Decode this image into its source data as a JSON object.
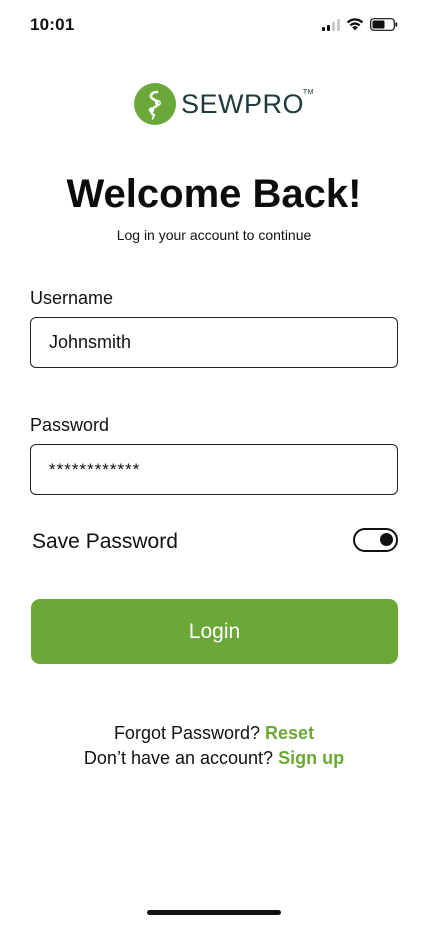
{
  "status_bar": {
    "time": "10:01",
    "battery_level": 0.6,
    "signal_bars_active": 2,
    "signal_bars_total": 4
  },
  "logo": {
    "text": "SEWPRO",
    "trademark": "TM",
    "brand_color": "#6ba838"
  },
  "header": {
    "title": "Welcome Back!",
    "subtitle": "Log in your account to continue"
  },
  "form": {
    "username_label": "Username",
    "username_value": "Johnsmith",
    "password_label": "Password",
    "password_value": "************",
    "save_password_label": "Save Password",
    "save_password_on": true
  },
  "actions": {
    "login_label": "Login"
  },
  "footer": {
    "forgot_text": "Forgot Password?",
    "reset_link": "Reset",
    "no_account_text": "Don’t have an account?",
    "signup_link": "Sign up"
  },
  "colors": {
    "accent": "#6ba838",
    "text": "#111111",
    "background": "#ffffff"
  }
}
